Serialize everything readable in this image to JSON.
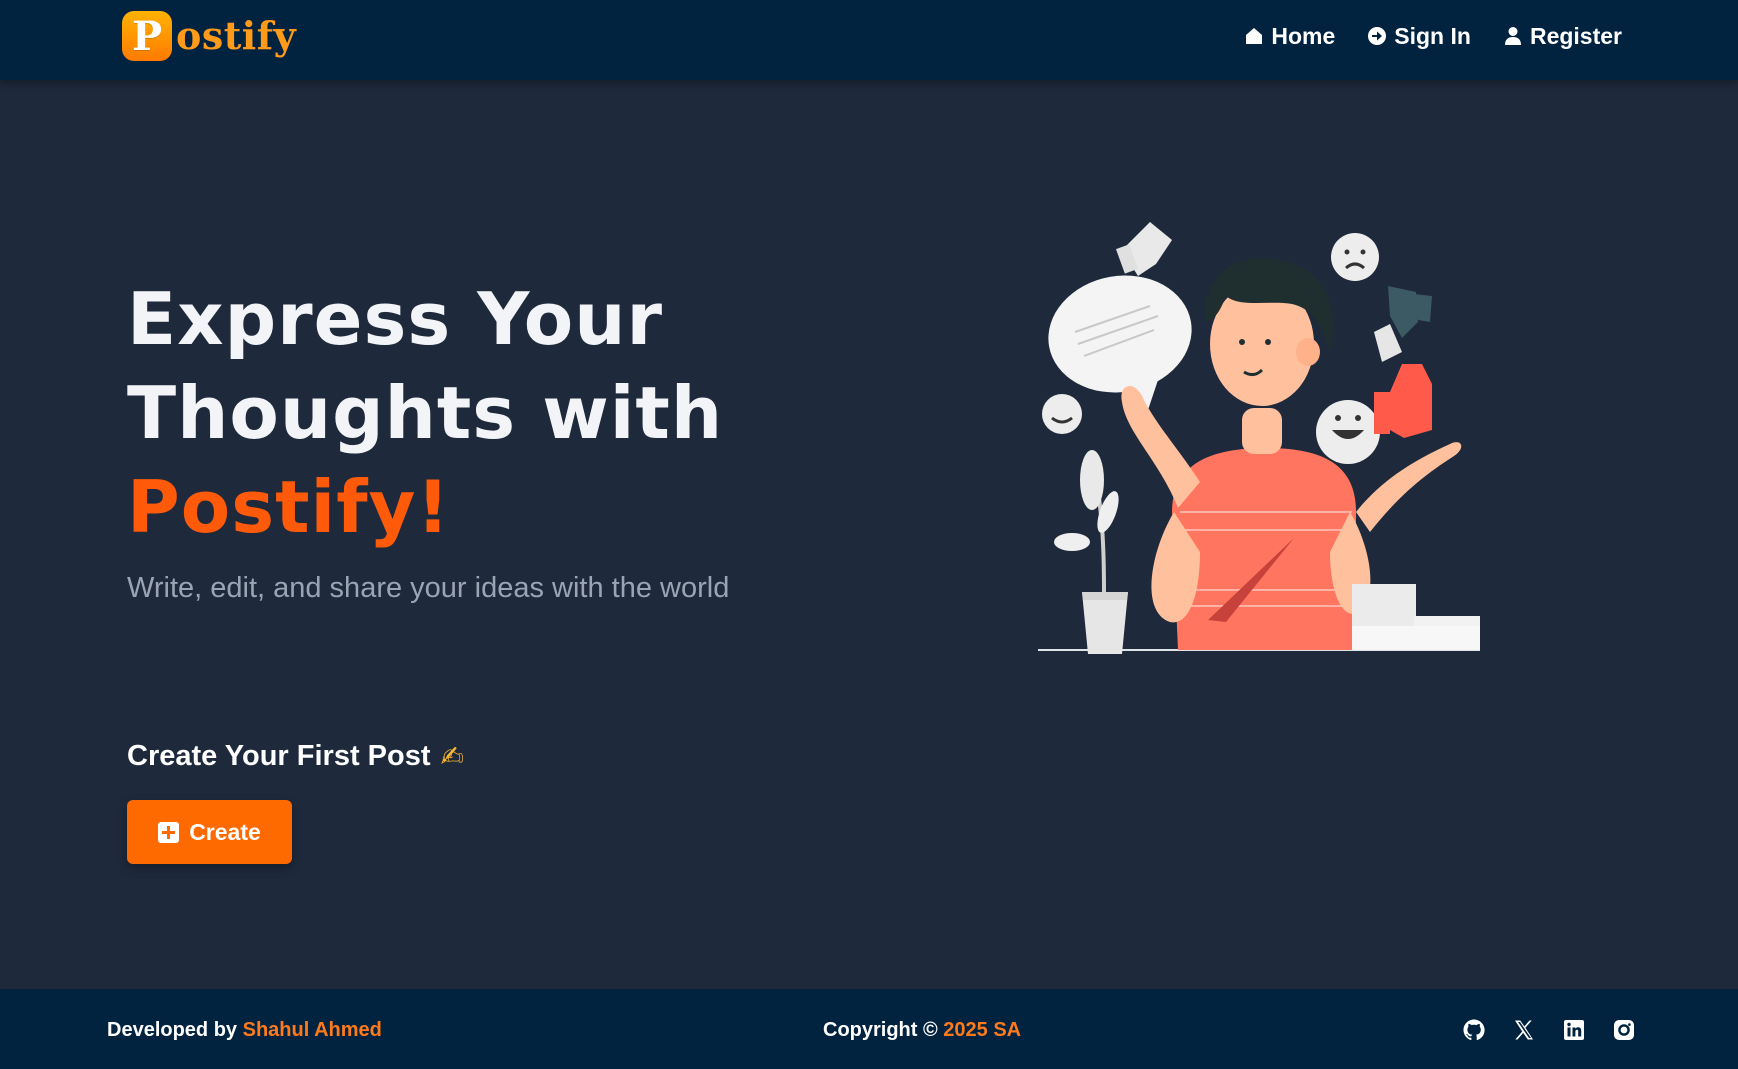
{
  "brand": {
    "mark_letter": "P",
    "name": "ostify"
  },
  "nav": {
    "items": [
      {
        "label": "Home",
        "icon": "home-icon"
      },
      {
        "label": "Sign In",
        "icon": "sign-in-icon"
      },
      {
        "label": "Register",
        "icon": "user-icon"
      }
    ]
  },
  "hero": {
    "title_line1": "Express Your",
    "title_line2": "Thoughts with",
    "title_accent": "Postify!",
    "subtitle": "Write, edit, and share your ideas with the world"
  },
  "cta": {
    "heading": "Create Your First Post",
    "heading_emoji": "✍",
    "button_label": "Create",
    "button_icon": "plus-square-icon"
  },
  "footer": {
    "developed_prefix": "Developed by",
    "developer_name": "Shahul Ahmed",
    "copyright_prefix": "Copyright ©",
    "copyright_highlight": "2025 SA",
    "socials": [
      "github-icon",
      "x-icon",
      "linkedin-icon",
      "instagram-icon"
    ]
  },
  "colors": {
    "header_bg": "#012340",
    "page_bg": "#1e293b",
    "accent": "#ff6a00",
    "brand_orange": "#ff9a1a"
  }
}
